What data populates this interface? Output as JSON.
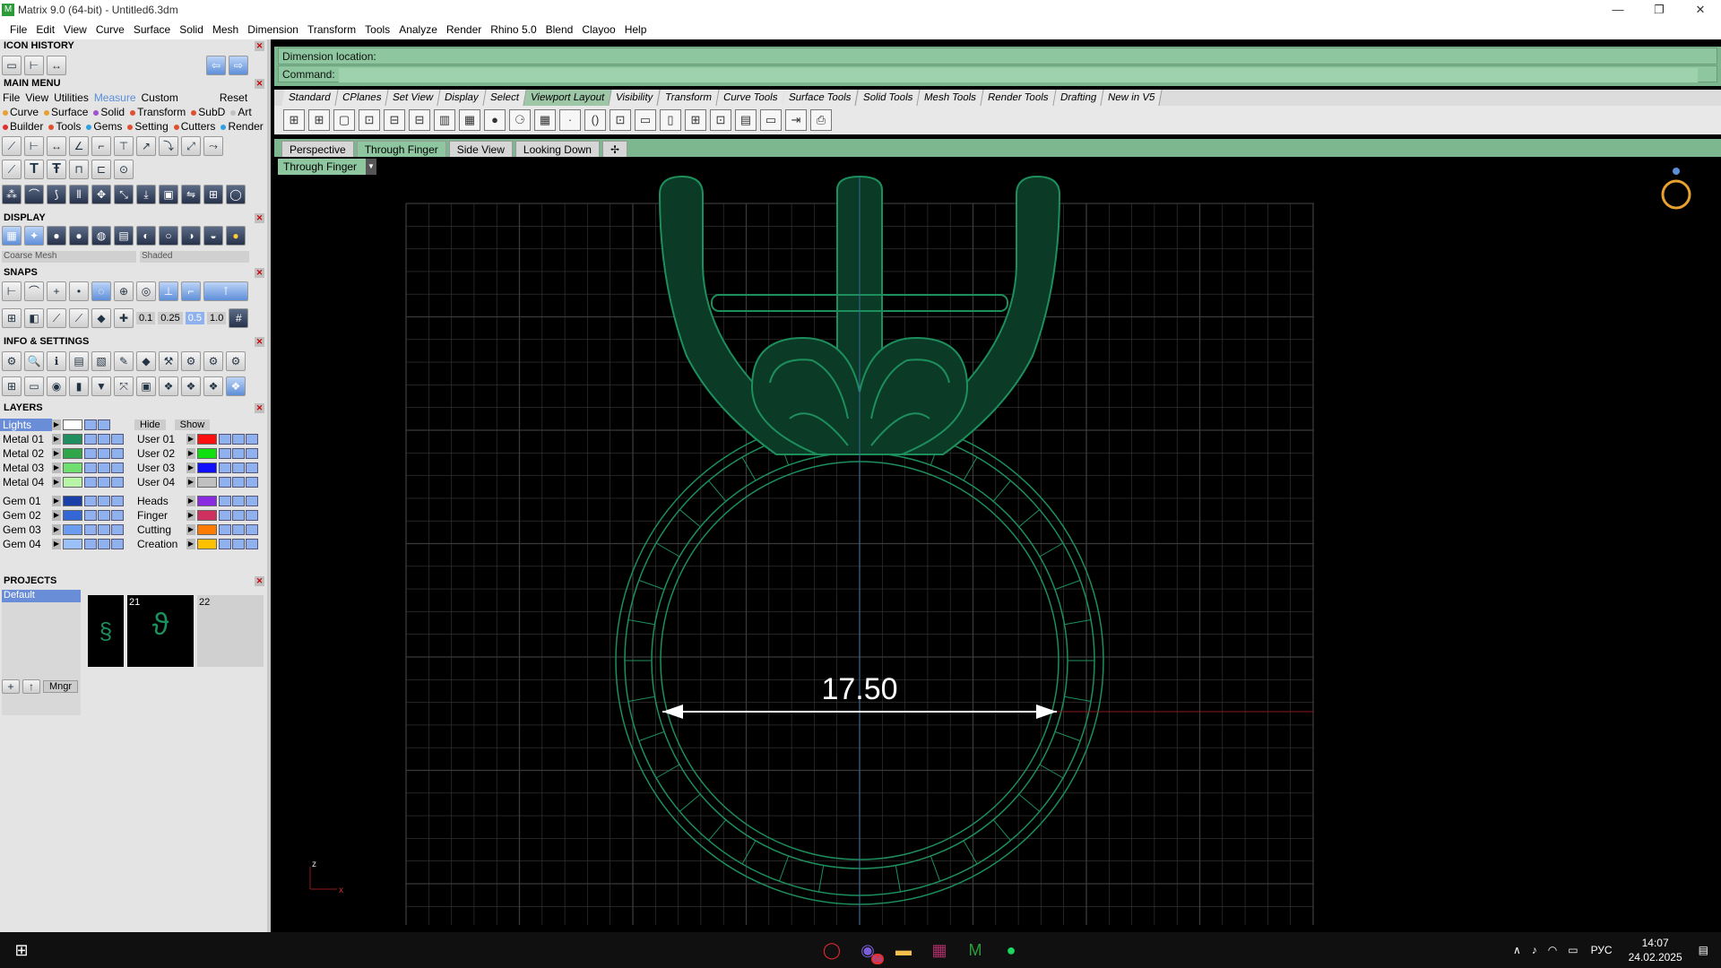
{
  "window": {
    "title": "Matrix 9.0 (64-bit) - Untitled6.3dm",
    "buttons": [
      "—",
      "❐",
      "✕"
    ]
  },
  "menu": [
    "File",
    "Edit",
    "View",
    "Curve",
    "Surface",
    "Solid",
    "Mesh",
    "Dimension",
    "Transform",
    "Tools",
    "Analyze",
    "Render",
    "Rhino 5.0",
    "Blend",
    "Clayoo",
    "Help"
  ],
  "panels": {
    "icon_history": "ICON HISTORY",
    "main_menu": "MAIN MENU",
    "display": "DISPLAY",
    "snaps": "SNAPS",
    "info_settings": "INFO & SETTINGS",
    "layers": "LAYERS",
    "projects": "PROJECTS"
  },
  "main_menu": {
    "row1": [
      "File",
      "View",
      "Utilities",
      "Measure",
      "Custom",
      "Reset"
    ],
    "row2": [
      "Curve",
      "Surface",
      "Solid",
      "Transform",
      "SubD",
      "Art"
    ],
    "row3": [
      "Builder",
      "Tools",
      "Gems",
      "Setting",
      "Cutters",
      "Render"
    ]
  },
  "display": {
    "mesh": "Coarse Mesh",
    "mode": "Shaded"
  },
  "snaps": {
    "values": [
      "0.1",
      "0.25",
      "0.5",
      "1.0"
    ]
  },
  "layers": {
    "lights": "Lights",
    "hide": "Hide",
    "show": "Show",
    "left": [
      {
        "name": "Metal 01",
        "color": "#1f8f5f"
      },
      {
        "name": "Metal 02",
        "color": "#2fa64a"
      },
      {
        "name": "Metal 03",
        "color": "#6fe06f"
      },
      {
        "name": "Metal 04",
        "color": "#b8f5a8"
      },
      {
        "name": "Gem 01",
        "color": "#1b3fa8"
      },
      {
        "name": "Gem 02",
        "color": "#3467d6"
      },
      {
        "name": "Gem 03",
        "color": "#6c9cf0"
      },
      {
        "name": "Gem 04",
        "color": "#9cc0f8"
      }
    ],
    "right": [
      {
        "name": "User 01",
        "color": "#ff1010"
      },
      {
        "name": "User 02",
        "color": "#10e010"
      },
      {
        "name": "User 03",
        "color": "#1010ff"
      },
      {
        "name": "User 04",
        "color": "#c0c0c0"
      },
      {
        "name": "Heads",
        "color": "#8a2be2"
      },
      {
        "name": "Finger",
        "color": "#d03060"
      },
      {
        "name": "Cutting",
        "color": "#ff7a00"
      },
      {
        "name": "Creation",
        "color": "#ffc000"
      }
    ]
  },
  "projects": {
    "selected": "Default",
    "thumbs": [
      "21",
      "22"
    ],
    "mngr": "Mngr"
  },
  "command": {
    "line1": "Dimension location:",
    "line2": "Command:"
  },
  "toolbar_tabs": [
    "Standard",
    "CPlanes",
    "Set View",
    "Display",
    "Select",
    "Viewport Layout",
    "Visibility",
    "Transform",
    "Curve Tools",
    "Surface Tools",
    "Solid Tools",
    "Mesh Tools",
    "Render Tools",
    "Drafting",
    "New in V5"
  ],
  "active_toolbar_tab": "Viewport Layout",
  "viewport_tabs": [
    "Perspective",
    "Through Finger",
    "Side View",
    "Looking Down"
  ],
  "active_viewport": "Through Finger",
  "viewport_name": "Through Finger",
  "dimension": {
    "value": "17.50"
  },
  "axes": {
    "z": "z",
    "x": "x"
  },
  "taskbar": {
    "apps": [
      "opera",
      "viber",
      "explorer",
      "winrar",
      "matrix",
      "spotify"
    ],
    "badge": "66",
    "lang": "РУС",
    "time": "14:07",
    "date": "24.02.2025"
  },
  "colors": {
    "wire": "#1d8f5c",
    "grid": "#3a3a3a",
    "accent": "#7db78f"
  }
}
